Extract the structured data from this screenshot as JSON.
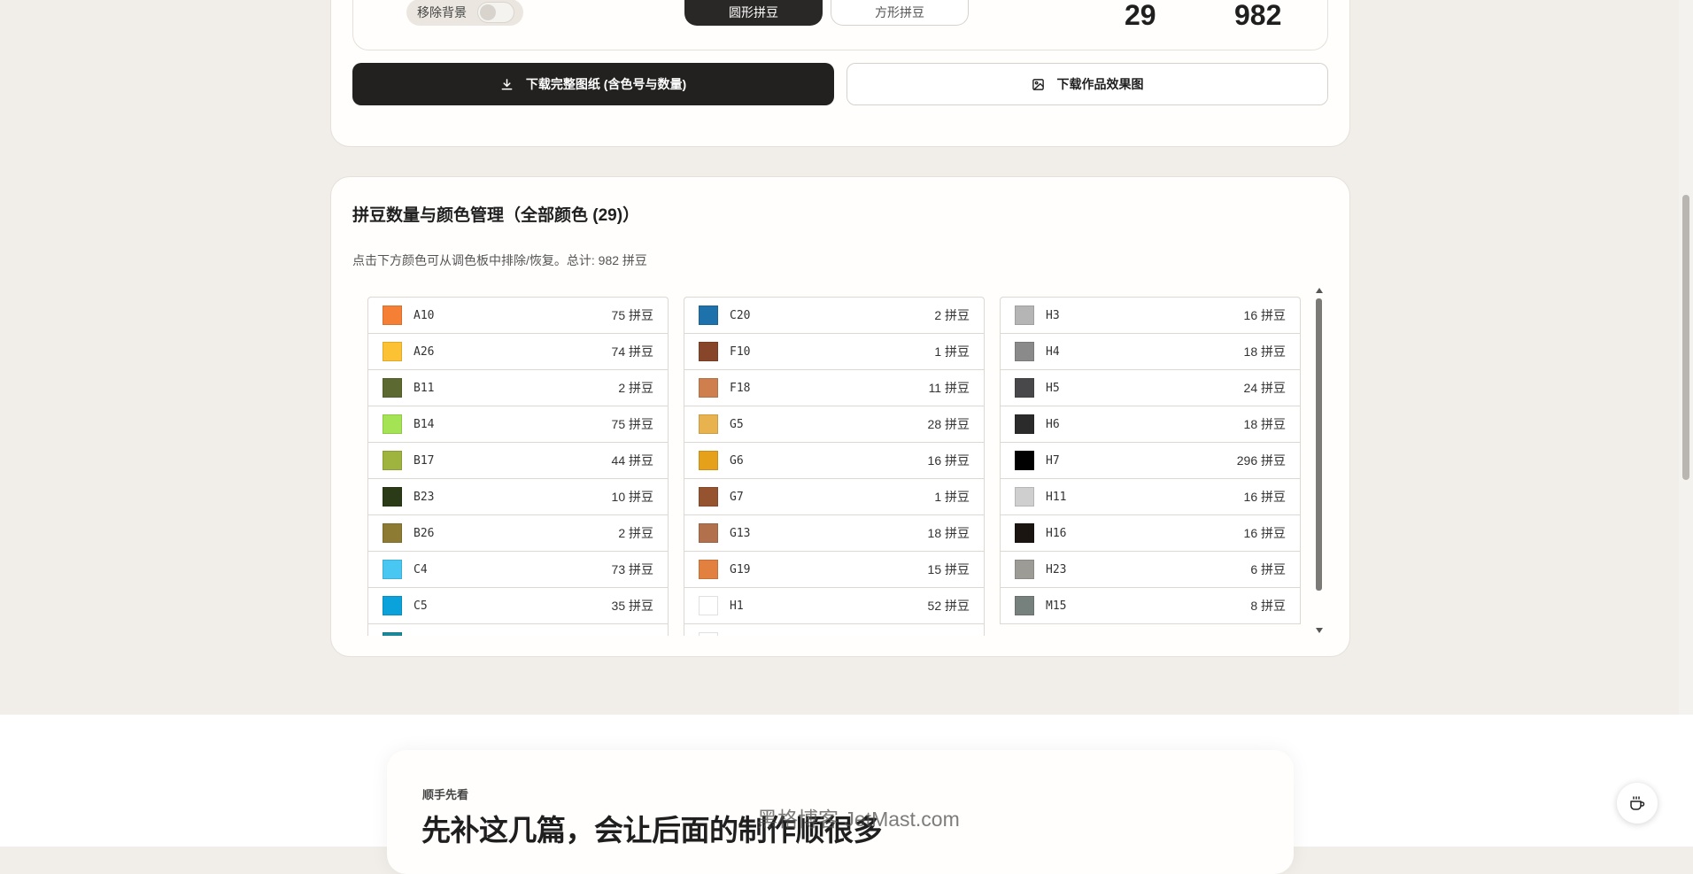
{
  "controls": {
    "remove_bg_label": "移除背景",
    "shape_round": "圆形拼豆",
    "shape_square": "方形拼豆"
  },
  "stats": {
    "color_count": "29",
    "bead_count": "982"
  },
  "buttons": {
    "download_full": "下载完整图纸 (含色号与数量)",
    "download_effect": "下载作品效果图"
  },
  "colors_panel": {
    "title": "拼豆数量与颜色管理（全部颜色 (29)）",
    "subtitle": "点击下方颜色可从调色板中排除/恢复。总计: 982 拼豆"
  },
  "columns": [
    [
      {
        "code": "A10",
        "count": "75 拼豆",
        "color": "#f57f35"
      },
      {
        "code": "A26",
        "count": "74 拼豆",
        "color": "#fdc134"
      },
      {
        "code": "B11",
        "count": "2 拼豆",
        "color": "#5c6a31"
      },
      {
        "code": "B14",
        "count": "75 拼豆",
        "color": "#a3e354"
      },
      {
        "code": "B17",
        "count": "44 拼豆",
        "color": "#9fb33f"
      },
      {
        "code": "B23",
        "count": "10 拼豆",
        "color": "#2b3a17"
      },
      {
        "code": "B26",
        "count": "2 拼豆",
        "color": "#8d7b33"
      },
      {
        "code": "C4",
        "count": "73 拼豆",
        "color": "#47c7f2"
      },
      {
        "code": "C5",
        "count": "35 拼豆",
        "color": "#0ba2dc"
      },
      {
        "code": "",
        "count": "",
        "color": "#1a8a9a"
      }
    ],
    [
      {
        "code": "C20",
        "count": "2 拼豆",
        "color": "#1d72ab"
      },
      {
        "code": "F10",
        "count": "1 拼豆",
        "color": "#87452a"
      },
      {
        "code": "F18",
        "count": "11 拼豆",
        "color": "#cf7f4e"
      },
      {
        "code": "G5",
        "count": "28 拼豆",
        "color": "#e8b24e"
      },
      {
        "code": "G6",
        "count": "16 拼豆",
        "color": "#e6a11a"
      },
      {
        "code": "G7",
        "count": "1 拼豆",
        "color": "#95532f"
      },
      {
        "code": "G13",
        "count": "18 拼豆",
        "color": "#b3704c"
      },
      {
        "code": "G19",
        "count": "15 拼豆",
        "color": "#e2803f"
      },
      {
        "code": "H1",
        "count": "52 拼豆",
        "color": "#ffffff"
      },
      {
        "code": "",
        "count": "",
        "color": "#ffffff"
      }
    ],
    [
      {
        "code": "H3",
        "count": "16 拼豆",
        "color": "#b5b5b5"
      },
      {
        "code": "H4",
        "count": "18 拼豆",
        "color": "#8a8a8a"
      },
      {
        "code": "H5",
        "count": "24 拼豆",
        "color": "#48484a"
      },
      {
        "code": "H6",
        "count": "18 拼豆",
        "color": "#2b2b2b"
      },
      {
        "code": "H7",
        "count": "296 拼豆",
        "color": "#010101"
      },
      {
        "code": "H11",
        "count": "16 拼豆",
        "color": "#cfcfcf"
      },
      {
        "code": "H16",
        "count": "16 拼豆",
        "color": "#1b1512"
      },
      {
        "code": "H23",
        "count": "6 拼豆",
        "color": "#9c9b96"
      },
      {
        "code": "M15",
        "count": "8 拼豆",
        "color": "#76807c"
      }
    ]
  ],
  "reading": {
    "eyebrow": "顺手先看",
    "headline": "先补这几篇，会让后面的制作顺很多"
  },
  "watermark": "黑格博客 JetMast.com",
  "icons": {
    "download": "download-icon",
    "image": "image-icon",
    "coffee": "coffee-icon"
  }
}
